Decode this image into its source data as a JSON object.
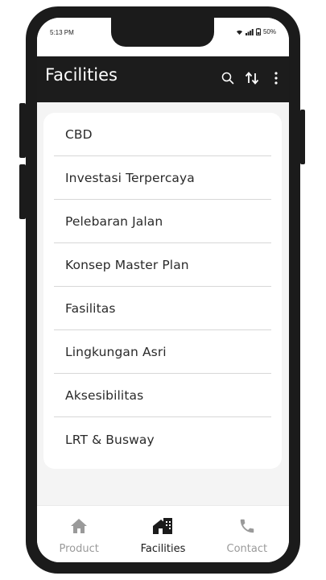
{
  "status_bar": {
    "time": "5:13 PM",
    "battery": "50%",
    "icons": [
      "wifi-icon",
      "signal-icon",
      "battery-icon"
    ]
  },
  "app_bar": {
    "title": "Facilities",
    "actions": [
      "search-icon",
      "sort-icon",
      "more-vert-icon"
    ]
  },
  "facilities": {
    "items": [
      {
        "label": "CBD"
      },
      {
        "label": "Investasi Terpercaya"
      },
      {
        "label": "Pelebaran Jalan"
      },
      {
        "label": "Konsep Master Plan"
      },
      {
        "label": "Fasilitas"
      },
      {
        "label": "Lingkungan Asri"
      },
      {
        "label": "Aksesibilitas"
      },
      {
        "label": "LRT & Busway"
      }
    ]
  },
  "bottom_nav": {
    "items": [
      {
        "label": "Product",
        "icon": "home-icon",
        "active": false
      },
      {
        "label": "Facilities",
        "icon": "building-icon",
        "active": true
      },
      {
        "label": "Contact",
        "icon": "phone-icon",
        "active": false
      }
    ]
  },
  "colors": {
    "app_bar": "#1c1c1c",
    "active_nav": "#1b1b1b",
    "inactive_nav": "#9a9a9a",
    "background": "#f4f4f4"
  }
}
